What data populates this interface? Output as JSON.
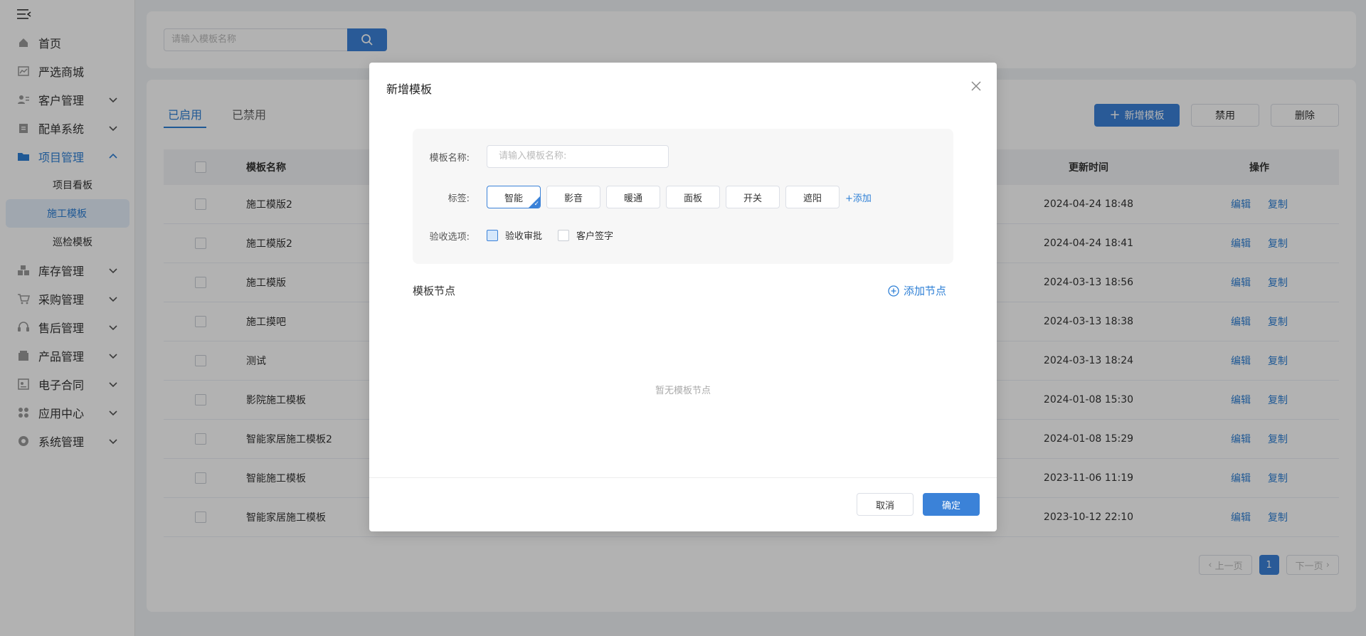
{
  "sidebar": {
    "items": [
      {
        "label": "首页",
        "icon": "home-icon",
        "has_children": false
      },
      {
        "label": "严选商城",
        "icon": "chart-icon",
        "has_children": false
      },
      {
        "label": "客户管理",
        "icon": "users-icon",
        "has_children": true
      },
      {
        "label": "配单系统",
        "icon": "clipboard-icon",
        "has_children": true
      },
      {
        "label": "项目管理",
        "icon": "folder-icon",
        "has_children": true,
        "expanded": true
      }
    ],
    "project_submenu": [
      "项目看板",
      "施工模板",
      "巡检模板"
    ],
    "active_sub": "施工模板",
    "items_after": [
      {
        "label": "库存管理",
        "icon": "inventory-icon"
      },
      {
        "label": "采购管理",
        "icon": "cart-icon"
      },
      {
        "label": "售后管理",
        "icon": "headset-icon"
      },
      {
        "label": "产品管理",
        "icon": "product-icon"
      },
      {
        "label": "电子合同",
        "icon": "contract-icon"
      },
      {
        "label": "应用中心",
        "icon": "apps-icon"
      },
      {
        "label": "系统管理",
        "icon": "settings-icon"
      }
    ]
  },
  "search": {
    "placeholder": "请输入模板名称"
  },
  "tabs": [
    "已启用",
    "已禁用"
  ],
  "toolbar": {
    "add_label": "新增模板",
    "disable_label": "禁用",
    "delete_label": "删除"
  },
  "table": {
    "headers": {
      "name": "模板名称",
      "updated": "更新时间",
      "ops": "操作"
    },
    "rows": [
      {
        "name": "施工模版2",
        "updated": "2024-04-24 18:48"
      },
      {
        "name": "施工模版2",
        "updated": "2024-04-24 18:41"
      },
      {
        "name": "施工模版",
        "updated": "2024-03-13 18:56"
      },
      {
        "name": "施工摸吧",
        "updated": "2024-03-13 18:38"
      },
      {
        "name": "测试",
        "updated": "2024-03-13 18:24"
      },
      {
        "name": "影院施工模板",
        "updated": "2024-01-08 15:30"
      },
      {
        "name": "智能家居施工模板2",
        "updated": "2024-01-08 15:29"
      },
      {
        "name": "智能施工模板",
        "updated": "2023-11-06 11:19"
      },
      {
        "name": "智能家居施工模板",
        "updated": "2023-10-12 22:10"
      }
    ],
    "op_edit": "编辑",
    "op_copy": "复制"
  },
  "pager": {
    "prev": "上一页",
    "current": "1",
    "next": "下一页"
  },
  "modal": {
    "title": "新增模板",
    "name_label": "模板名称:",
    "name_placeholder": "请输入模板名称:",
    "tags_label": "标签:",
    "tags": [
      "智能",
      "影音",
      "暖通",
      "面板",
      "开关",
      "遮阳"
    ],
    "selected_tag": "智能",
    "add_tag": "+添加",
    "acceptance_label": "验收选项:",
    "acceptance_options": [
      {
        "label": "验收审批",
        "checked": true
      },
      {
        "label": "客户签字",
        "checked": false
      }
    ],
    "nodes_title": "模板节点",
    "add_node": "添加节点",
    "empty_nodes": "暂无模板节点",
    "cancel": "取消",
    "confirm": "确定"
  },
  "colors": {
    "accent": "#3b82d8",
    "link": "#2f80d6"
  }
}
